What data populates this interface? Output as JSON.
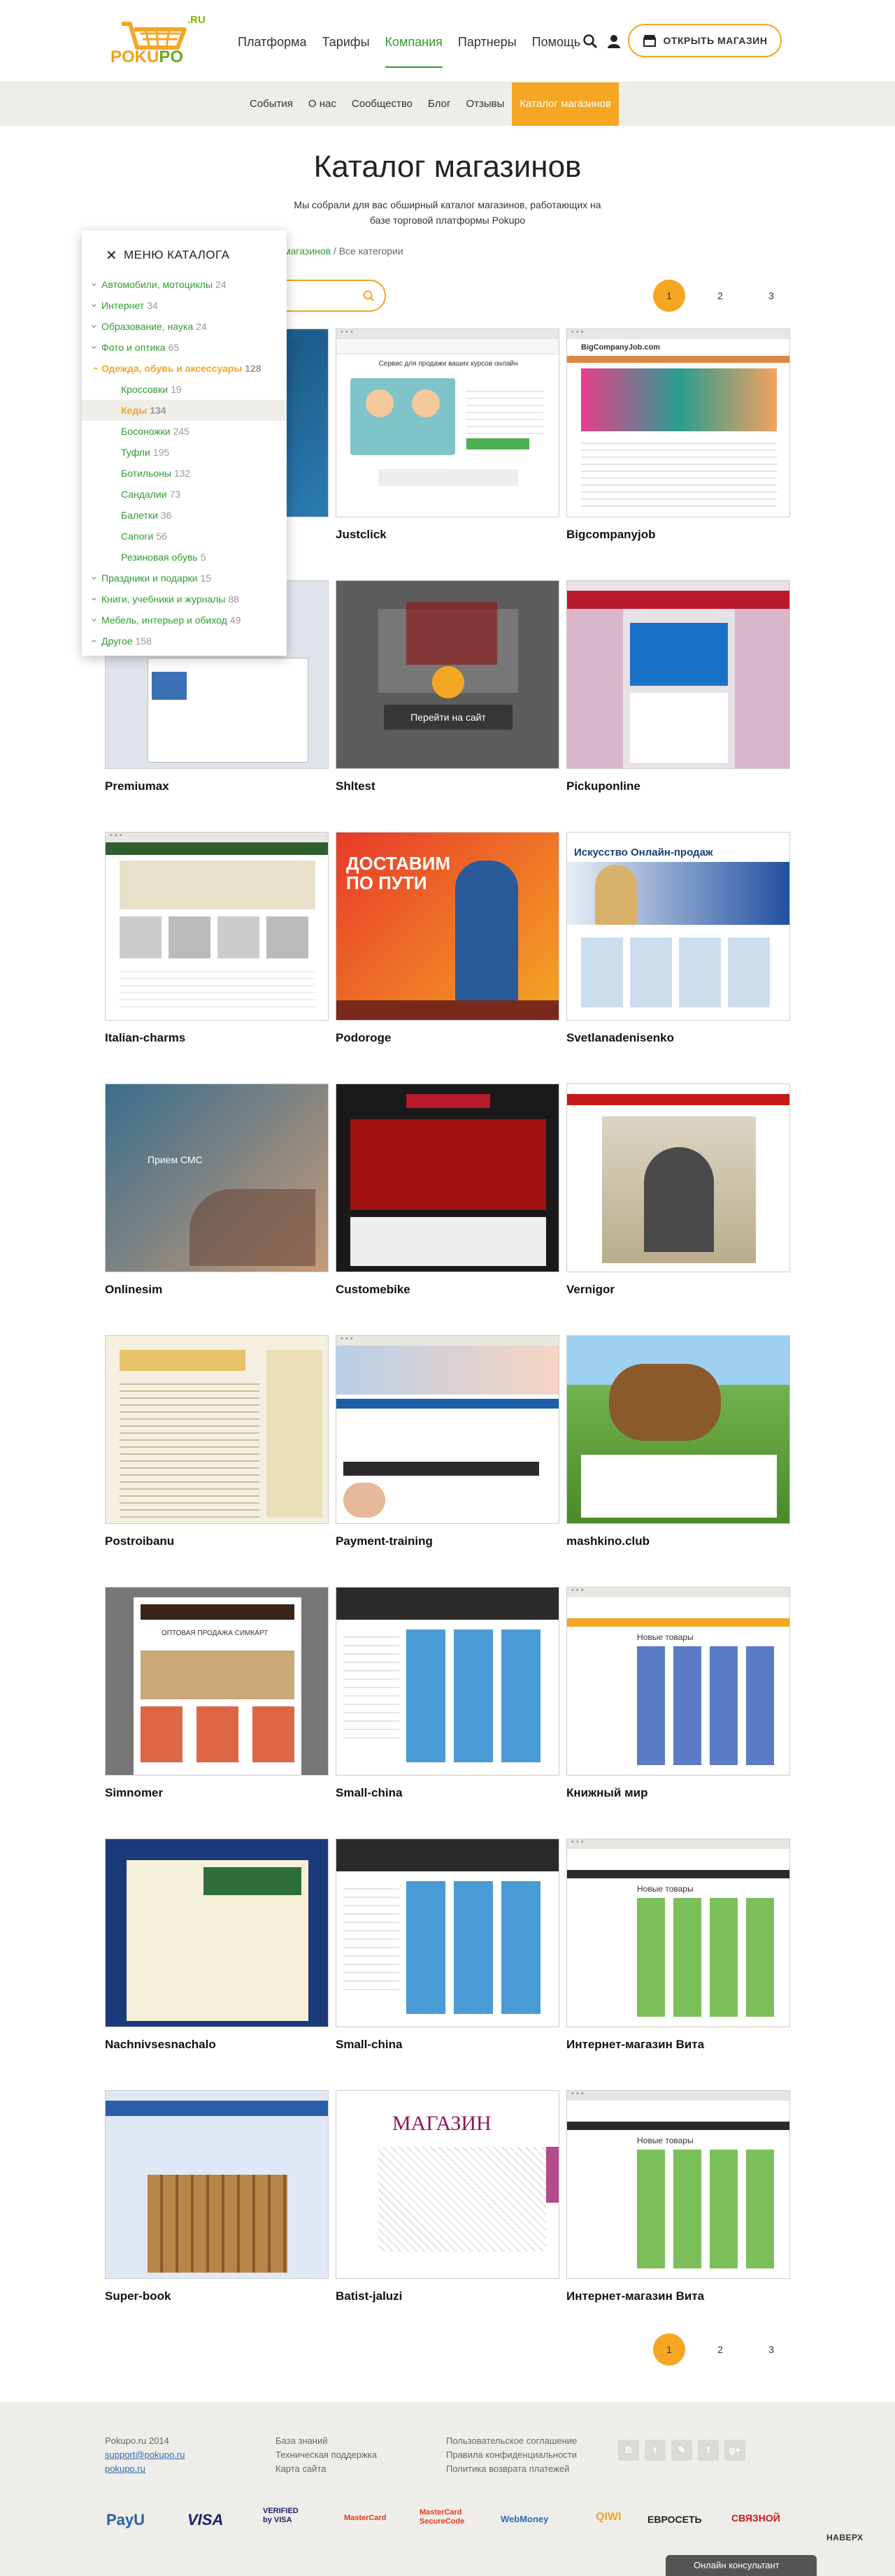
{
  "brand": {
    "logo_text_a": "POKU",
    "logo_text_b": "PO",
    "logo_ru": ".RU",
    "accent": "#f5a623",
    "green": "#2e9c2e"
  },
  "header": {
    "nav": [
      "Платформа",
      "Тарифы",
      "Компания",
      "Партнеры",
      "Помощь"
    ],
    "active_nav": "Компания",
    "open_shop": "ОТКРЫТЬ МАГАЗИН"
  },
  "subnav": {
    "items": [
      "События",
      "О нас",
      "Сообщество",
      "Блог",
      "Отзывы",
      "Каталог магазинов"
    ],
    "active": "Каталог магазинов"
  },
  "page": {
    "title": "Каталог магазинов",
    "intro": "Мы собрали для вас обширный каталог магазинов, работающих на базе торговой платформы Pokupo",
    "breadcrumb_link": "магазинов",
    "breadcrumb_rest": " / Все категории"
  },
  "pagination": {
    "pages": [
      "1",
      "2",
      "3"
    ],
    "current": "1"
  },
  "menu": {
    "title": "МЕНЮ КАТАЛОГА",
    "items": [
      {
        "label": "Автомобили, мотоциклы",
        "count": "24"
      },
      {
        "label": "Интернет",
        "count": "34"
      },
      {
        "label": "Образование, наука",
        "count": "24"
      },
      {
        "label": "Фото и оптика",
        "count": "65"
      },
      {
        "label": "Одежда, обувь и аксессуары",
        "count": "128"
      },
      {
        "label": "Праздники и подарки",
        "count": "15"
      },
      {
        "label": "Книги, учебники и журналы",
        "count": "88"
      },
      {
        "label": "Мебель, интерьер и обиход",
        "count": "49"
      },
      {
        "label": "Другое",
        "count": "158"
      }
    ],
    "subitems": [
      {
        "label": "Кроссовки",
        "count": "19"
      },
      {
        "label": "Кеды",
        "count": "134"
      },
      {
        "label": "Босоножки",
        "count": "245"
      },
      {
        "label": "Туфли",
        "count": "195"
      },
      {
        "label": "Ботильоны",
        "count": "132"
      },
      {
        "label": "Сандалии",
        "count": "73"
      },
      {
        "label": "Балетки",
        "count": "36"
      },
      {
        "label": "Сапоги",
        "count": "56"
      },
      {
        "label": "Резиновая обувь",
        "count": "5"
      }
    ]
  },
  "shops": [
    "",
    "Justclick",
    "Bigcompanyjob",
    "Premiumax",
    "Shltest",
    "Pickuponline",
    "Italian-charms",
    "Podoroge",
    "Svetlanadenisenko",
    "Onlinesim",
    "Customebike",
    "Vernigor",
    "Postroibanu",
    "Payment-training",
    "mashkino.club",
    "Simnomer",
    "Small-china",
    "Книжный мир",
    "Nachnivsesnachalo",
    "Small-china",
    "Интернет-магазин Вита",
    "Super-book",
    "Batist-jaluzi",
    "Интернет-магазин Вита"
  ],
  "shot_texts": {
    "justclick_headline": "Сервис для продажи ваших курсов онлайн",
    "bigcompanyjob_logo": "BigCompanyJob.com",
    "podoroge_big": "ДОСТАВИМ ПО ПУТИ",
    "svetlana_banner": "Искусство Онлайн-продаж",
    "onlinesim_title": "Прием СМС",
    "mashkino_hint": "",
    "simnomer_title": "ОПТОВАЯ ПРОДАЖА СИМКАРТ",
    "books_title": "Новые товары",
    "batist_title": "МАГАЗИН",
    "go_button": "Перейти на сайт"
  },
  "footer": {
    "col1": [
      "Pokupo.ru 2014",
      "support@pokupo.ru",
      "pokupo.ru"
    ],
    "col2": [
      "База знаний",
      "Техническая поддержка",
      "Карта сайта"
    ],
    "col3": [
      "Пользовательское соглашение",
      "Правила конфиденциальности",
      "Политика возврата платежей"
    ],
    "socials": [
      "В",
      "t",
      "✎",
      "f",
      "g+"
    ],
    "payments": [
      "PayU",
      "VISA",
      "VERIFIED by VISA",
      "MasterCard",
      "MasterCard SecureCode",
      "WebMoney",
      "QIWI",
      "ЕВРОСЕТЬ",
      "СВЯЗНОЙ"
    ],
    "up": "НАВЕРХ",
    "chat": "Онлайн консультант"
  }
}
